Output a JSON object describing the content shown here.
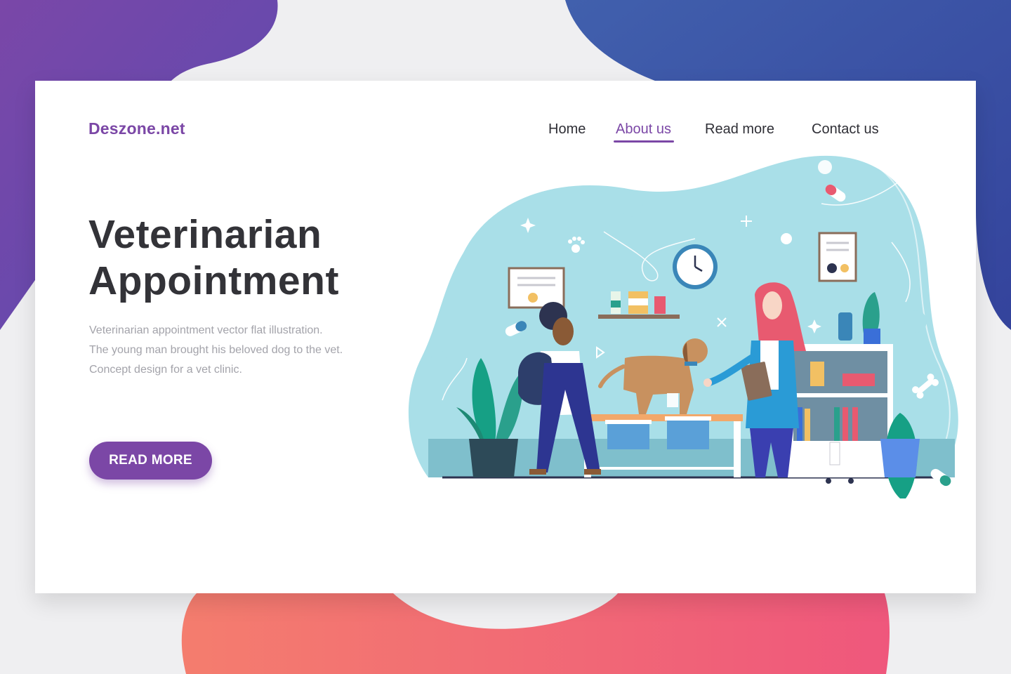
{
  "site": {
    "brand": "Deszone.net"
  },
  "nav": {
    "items": [
      {
        "label": "Home",
        "active": false
      },
      {
        "label": "About us",
        "active": true
      },
      {
        "label": "Read more",
        "active": false
      },
      {
        "label": "Contact us",
        "active": false
      }
    ]
  },
  "hero": {
    "title_line1": "Veterinarian",
    "title_line2": "Appointment",
    "description_lines": [
      "Veterinarian appointment vector flat illustration.",
      "The young man brought his beloved dog to the vet.",
      "Concept design for a vet clinic."
    ],
    "cta_label": "READ MORE"
  },
  "colors": {
    "accent": "#7b47a6",
    "heading": "#333338",
    "body_text": "#a3a3aa",
    "blob_purple": "#6a4aa8",
    "blob_blue": "#3b4fa0",
    "blob_coral": "#f2706e",
    "illustration_bg": "#a9dfe8"
  },
  "illustration": {
    "subject": "veterinarian-clinic-scene",
    "icons": [
      "clock-icon",
      "pill-icon",
      "paw-print-icon",
      "bone-icon",
      "certificate-icon",
      "potted-plant-icon",
      "shelf-icon"
    ]
  }
}
